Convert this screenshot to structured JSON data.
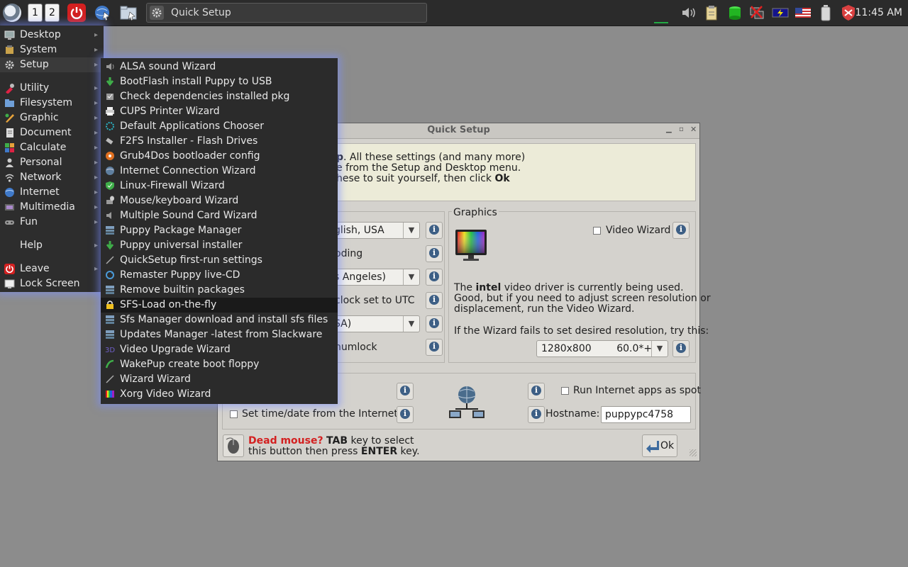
{
  "taskbar": {
    "workspaces": [
      "1",
      "2"
    ],
    "task_title": "Quick Setup",
    "clock": "11:45 AM"
  },
  "main_menu": {
    "items": [
      {
        "label": "Desktop",
        "icon": "desktop-icon",
        "submenu": true
      },
      {
        "label": "System",
        "icon": "system-icon",
        "submenu": true
      },
      {
        "label": "Setup",
        "icon": "setup-gear-icon",
        "submenu": true
      },
      {
        "label": "Utility",
        "icon": "utility-icon",
        "submenu": true
      },
      {
        "label": "Filesystem",
        "icon": "folder-icon",
        "submenu": true
      },
      {
        "label": "Graphic",
        "icon": "graphic-icon",
        "submenu": true
      },
      {
        "label": "Document",
        "icon": "document-icon",
        "submenu": true
      },
      {
        "label": "Calculate",
        "icon": "calculate-icon",
        "submenu": true
      },
      {
        "label": "Personal",
        "icon": "personal-icon",
        "submenu": true
      },
      {
        "label": "Network",
        "icon": "network-icon",
        "submenu": true
      },
      {
        "label": "Internet",
        "icon": "internet-icon",
        "submenu": true
      },
      {
        "label": "Multimedia",
        "icon": "multimedia-icon",
        "submenu": true
      },
      {
        "label": "Fun",
        "icon": "fun-icon",
        "submenu": true
      },
      {
        "label": "Help",
        "icon": "",
        "submenu": true
      },
      {
        "label": "Leave",
        "icon": "power-icon",
        "submenu": true
      },
      {
        "label": "Lock Screen",
        "icon": "lock-screen-icon",
        "submenu": false
      }
    ]
  },
  "setup_menu": {
    "items": [
      "ALSA sound Wizard",
      "BootFlash install Puppy to USB",
      "Check dependencies installed pkg",
      "CUPS Printer Wizard",
      "Default Applications Chooser",
      "F2FS Installer - Flash Drives",
      "Grub4Dos bootloader config",
      "Internet Connection Wizard",
      "Linux-Firewall Wizard",
      "Mouse/keyboard Wizard",
      "Multiple Sound Card Wizard",
      "Puppy Package Manager",
      "Puppy universal installer",
      "QuickSetup first-run settings",
      "Remaster Puppy live-CD",
      "Remove builtin packages",
      "SFS-Load on-the-fly",
      "Sfs Manager download and install sfs files",
      "Updates Manager -latest from Slackware",
      "Video Upgrade Wizard",
      "WakePup create boot floppy",
      "Wizard Wizard",
      "Xorg Video Wizard"
    ],
    "highlighted_index": 16
  },
  "quick_setup": {
    "title": "Quick Setup",
    "intro_line1_bold": "p",
    "intro_line1_rest": ". All these settings (and many more)",
    "intro_line2": "e from the Setup and Desktop menu.",
    "intro_line3_a": "hese to suit yourself, then click ",
    "intro_line3_bold": "Ok",
    "locale_value": "glish, USA",
    "coding_label": "oding",
    "timezone_value": "s Angeles)",
    "utc_label": "clock set to UTC",
    "keyboard_value": "SA)",
    "numlock_label": "numlock",
    "graphics": {
      "legend": "Graphics",
      "video_wizard_label": "Video Wizard",
      "driver_text_a": "The ",
      "driver_name": "intel",
      "driver_text_b": " video driver is currently being used.",
      "driver_line2": "Good, but if you need to adjust screen resolution or",
      "driver_line3": "displacement, run the Video Wizard.",
      "fail_text": "If the Wizard fails to set desired resolution, try this:",
      "resolution_value": "1280x800        60.0*+"
    },
    "network": {
      "run_spot_label": "Run Internet apps as spot",
      "set_time_label": "Set time/date from the Internet",
      "hostname_label": "Hostname:",
      "hostname_value": "puppypc4758"
    },
    "footer": {
      "dead_mouse": "Dead mouse?",
      "tab_key": "TAB",
      "line1_rest": " key to select",
      "line2_a": "this button then press ",
      "enter_key": "ENTER",
      "line2_b": " key.",
      "ok_label": "Ok"
    }
  },
  "colors": {
    "accent_red": "#d32020",
    "menu_bg": "#2d2d2d",
    "window_bg": "#d4d2cd"
  }
}
